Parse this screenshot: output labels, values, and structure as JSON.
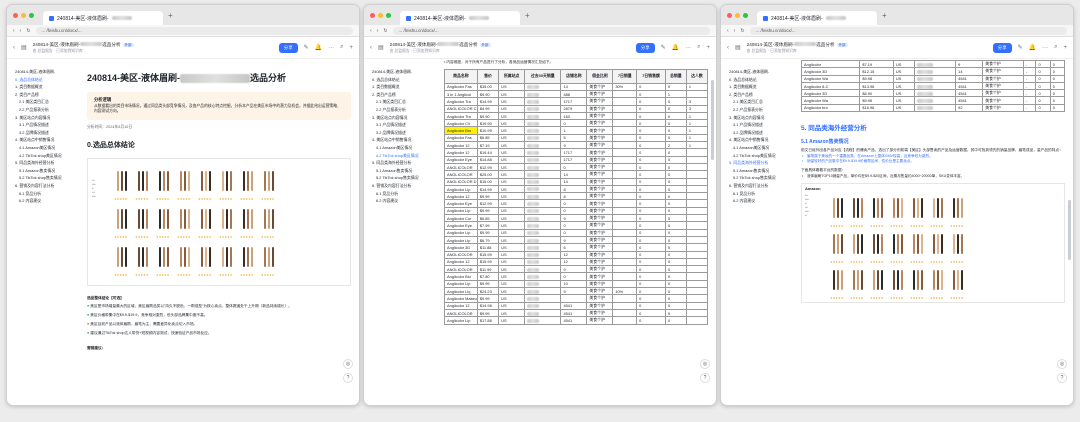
{
  "window_tab_title": "240814-美区-液体眉刷-",
  "url_text": "... /feishu.cn/docx/...",
  "doc_title_short": "240814-美区-液体眉刷-",
  "doc_title_suffix": "选品分析",
  "doc_tag": "外部",
  "doc_sub": "由 总监报告 · 已添加到知识库",
  "share_label": "分享",
  "edit_label": "编辑",
  "window1": {
    "sidebar": [
      "240814-美区-液体眉刷-",
      "0. 选品总体结论",
      "1. 类目数据概览",
      "2. 类目产品榜",
      "2.1 美区类目汇总",
      "2.2 产品报表分析",
      "3. 美区站点内容情况",
      "3.1 产品情况描述",
      "3.2 品牌情况描述",
      "4. 美区站点中销售情况",
      "4.1 Amazon美区情况",
      "4.2 TikTok shop美区情况",
      "5. 同品类海外经营分析",
      "5.1 Amazon售卖情况",
      "5.2 TikTok shop售卖情况",
      "6. 营销及内容打法分析",
      "6.1 竞品分析",
      "6.2 内容建议"
    ],
    "h1_prefix": "240814-美区-液体眉刷-",
    "h1_suffix": "选品分析",
    "box_title": "分析逻辑",
    "box_body": "从数据看出的类目市场情况，通过同品类头部竞争情况，及各产品的核心特点挖掘，分析本产品在美区市场中的潜力及机会，并据此给出运营策略、内容测试方向。",
    "date_label": "分析时间：2024年8月16日",
    "section_title": "0.选品总体结论",
    "conclusion_heading": "选品整体结论【可选】",
    "conclusions": [
      "美区是市场增量最大的区域，美区眉刷品类以“持久不脱色、一刷成型”为核心卖点，整体赛道处于上升期（新品持续增长）。",
      "美区价格带集中在$9.9-$19.9，竞争相对激烈，但头部品牌集中度不高。",
      "美区目前产品以液体眉刷、眉笔为主，需要差异化卖点切入市场。",
      "建议通过TikTok shop达人带货+短视频内容测试，快速验证产品市场反应。"
    ],
    "bottom_heading": "营销建议："
  },
  "window2": {
    "sidebar": [
      "240814-美区-液体眉刷-",
      "0. 选品总体结论",
      "1. 类目数据概览",
      "2. 类目产品榜",
      "2.1 美区类目汇总",
      "2.2 产品报表分析",
      "3. 美区站点内容情况",
      "3.1 产品情况描述",
      "3.2 品牌情况描述",
      "4. 美区站点中销售情况",
      "4.1 Amazon美区情况",
      "4.2 TikTok shop美区情况",
      "5. 同品类海外经营分析",
      "5.1 Amazon售卖情况",
      "5.2 TikTok shop售卖情况",
      "6. 营销及内容打法分析",
      "6.1 竞品分析",
      "6.2 内容建议"
    ],
    "intro": "• 内容维度，对于所有产品进行了分析，各竞品运营情况汇总如下。",
    "columns": [
      "商品名称",
      "售价",
      "所属站点",
      "过去30天销量",
      "店铺名称",
      "佣金比例",
      "7日销量",
      "7日销售额",
      "总销量",
      "达人数"
    ],
    "rows": [
      [
        "Anglicolor Fas",
        "$35.00",
        "US",
        "",
        "14",
        "美食个护",
        "30%",
        "0",
        "0",
        "1"
      ],
      [
        "3 in 1 Anglicol",
        "$9.90",
        "US",
        "",
        "488",
        "美食个护",
        "",
        "0",
        "1",
        ""
      ],
      [
        "Anglicolor Tra",
        "$14.99",
        "US",
        "",
        "1717",
        "美食个护",
        "",
        "0",
        "0",
        "3"
      ],
      [
        "ANGLICOLOR C",
        "$4.99",
        "US",
        "",
        "2879",
        "美食个护",
        "",
        "0",
        "0",
        "3"
      ],
      [
        "Anglicolor Tra",
        "$9.90",
        "US",
        "",
        "160",
        "美食个护",
        "",
        "0",
        "0",
        "1"
      ],
      [
        "Anglicolor Cli",
        "$19.90",
        "US",
        "",
        "0",
        "美食个护",
        "",
        "0",
        "0",
        "1"
      ],
      [
        "Anglicolor Bro",
        "$10.99",
        "US",
        "",
        "1",
        "美食个护",
        "",
        "0",
        "0",
        "1"
      ],
      [
        "Anglicolor Fas",
        "$6.85",
        "US",
        "",
        "5",
        "美食个护",
        "",
        "0",
        "0",
        "1"
      ],
      [
        "Anglicolor 12",
        "$7.19",
        "US",
        "",
        "9",
        "美食个护",
        "",
        "0",
        "2",
        "1"
      ],
      [
        "Anglicolor 12",
        "$19.44",
        "US",
        "",
        "1717",
        "美食个护",
        "",
        "0",
        "0",
        ""
      ],
      [
        "Anglicolor Eye",
        "$14.88",
        "US",
        "",
        "1717",
        "美食个护",
        "",
        "0",
        "0",
        ""
      ],
      [
        "ANGLICOLOR",
        "$12.99",
        "US",
        "",
        "0",
        "美食个护",
        "",
        "0",
        "0",
        ""
      ],
      [
        "ANGLICOLOR",
        "$25.00",
        "US",
        "",
        "14",
        "美食个护",
        "",
        "0",
        "0",
        ""
      ],
      [
        "ANGLICOLOR D",
        "$15.00",
        "US",
        "",
        "14",
        "美食个护",
        "",
        "0",
        "0",
        ""
      ],
      [
        "Anglicolor Lip",
        "$14.99",
        "US",
        "",
        "8",
        "美食个护",
        "",
        "0",
        "0",
        ""
      ],
      [
        "Anglicolor 12",
        "$9.99",
        "US",
        "",
        "8",
        "美食个护",
        "",
        "0",
        "0",
        ""
      ],
      [
        "Anglicolor Eye",
        "$12.99",
        "US",
        "",
        "0",
        "美食个护",
        "",
        "0",
        "0",
        ""
      ],
      [
        "Anglicolor Lip",
        "$9.99",
        "US",
        "",
        "0",
        "美食个护",
        "",
        "0",
        "0",
        ""
      ],
      [
        "Anglicolor Cor",
        "$6.85",
        "US",
        "",
        "9",
        "美食个护",
        "",
        "0",
        "0",
        ""
      ],
      [
        "Anglicolor Eye",
        "$7.99",
        "US",
        "",
        "0",
        "美食个护",
        "",
        "0",
        "0",
        ""
      ],
      [
        "Anglicolor Lip",
        "$9.99",
        "US",
        "",
        "0",
        "美食个护",
        "",
        "0",
        "0",
        ""
      ],
      [
        "Anglicolor Lip",
        "$6.79",
        "US",
        "",
        "9",
        "美食个护",
        "",
        "0",
        "0",
        ""
      ],
      [
        "Anglicolor 3D",
        "$11.88",
        "US",
        "",
        "6",
        "美食个护",
        "",
        "0",
        "0",
        ""
      ],
      [
        "ANGLICOLOR",
        "$15.99",
        "US",
        "",
        "12",
        "美食个护",
        "",
        "0",
        "0",
        ""
      ],
      [
        "Anglicolor 12",
        "$15.99",
        "US",
        "",
        "12",
        "美食个护",
        "",
        "0",
        "0",
        ""
      ],
      [
        "ANGLICOLOR",
        "$11.99",
        "US",
        "",
        "9",
        "美食个护",
        "",
        "0",
        "0",
        ""
      ],
      [
        "Anglicolor Blu",
        "$7.80",
        "US",
        "",
        "0",
        "美食个护",
        "",
        "0",
        "0",
        ""
      ],
      [
        "Anglicolor Lip",
        "$9.99",
        "US",
        "",
        "10",
        "美食个护",
        "",
        "0",
        "0",
        ""
      ],
      [
        "Anglicolor Liq",
        "$24.23",
        "US",
        "",
        "9",
        "美食个护",
        "10%",
        "0",
        "0",
        ""
      ],
      [
        "Anglicolor Makeup",
        "$9.99",
        "US",
        "",
        "",
        "美食个护",
        "",
        "0",
        "0",
        ""
      ],
      [
        "Anglicolor 12",
        "$14.98",
        "US",
        "",
        "4541",
        "美食个护",
        "",
        "0",
        "0",
        ""
      ],
      [
        "ANGLICOLOR",
        "$9.99",
        "US",
        "",
        "4541",
        "美食个护",
        "",
        "0",
        "0",
        ""
      ],
      [
        "Anglicolor Lip",
        "$17.88",
        "US",
        "",
        "4541",
        "美食个护",
        "",
        "0",
        "0",
        ""
      ]
    ]
  },
  "window3": {
    "sidebar": [
      "240814-美区-液体眉刷-",
      "0. 选品总体结论",
      "1. 类目数据概览",
      "2. 类目产品榜",
      "2.1 美区类目汇总",
      "2.2 产品报表分析",
      "3. 美区站点内容情况",
      "3.1 产品情况描述",
      "3.2 品牌情况描述",
      "4. 美区站点中销售情况",
      "4.1 Amazon美区情况",
      "4.2 TikTok shop美区情况",
      "5. 同品类海外经营分析",
      "5.1 Amazon售卖情况",
      "5.2 TikTok shop售卖情况",
      "6. 营销及内容打法分析",
      "6.1 竞品分析",
      "6.2 内容建议"
    ],
    "rows": [
      [
        "Anglicolor",
        "$7.19",
        "US",
        "9",
        "美食个护",
        "-",
        "0",
        "0"
      ],
      [
        "Anglicolor 3D",
        "$12.15",
        "US",
        "14",
        "美食个护",
        "-",
        "0",
        "0"
      ],
      [
        "Anglicolor Wa",
        "$9.98",
        "US",
        "4541",
        "美食个护",
        "-",
        "0",
        "0"
      ],
      [
        "Anglicolor 8-C",
        "$13.98",
        "US",
        "4541",
        "美食个护",
        "-",
        "0",
        "0"
      ],
      [
        "Anglicolor 3D",
        "$8.90",
        "US",
        "4541",
        "美食个护",
        "-",
        "0",
        "0"
      ],
      [
        "Anglicolor Wa",
        "$9.96",
        "US",
        "4541",
        "美食个护",
        "-",
        "0",
        "0"
      ],
      [
        "Anglicolor bro",
        "$16.96",
        "US",
        "92",
        "美食个护",
        "-",
        "0",
        "0"
      ]
    ],
    "section5": "5. 同品类海外经营分析",
    "section51": "5.1 Amazon售卖情况",
    "para": "前文已经列出各产品对应【流程】的爆卖产品，选出了部分剂前端【美区】头部售卖的产品及运营数据，其中可找到领先的销量品牌，眉笔成品，量产品的特点：",
    "bullets": [
      "眉笔属于美妆的一个重要品类，在Amazon上整体GMV较高，且竞争较为激烈。",
      "销量较好的产品集中在$9.9-$19.9价格带区间，性价比是主要卖点。"
    ],
    "note": "下面具体看看平台的数据：",
    "bullet3": "液体眉刷TOP10销量产品，单价均在$9.9-$20区间，近期月售量约4000~20000单，SKU变体丰富。",
    "amazon_label": "Amazon"
  }
}
